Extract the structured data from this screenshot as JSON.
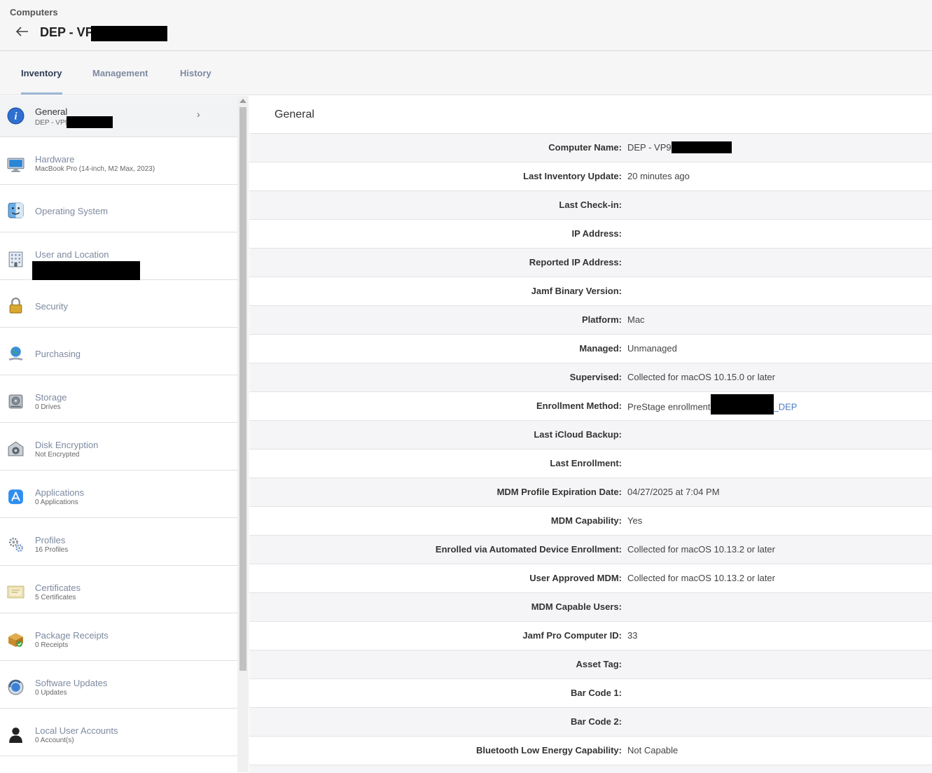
{
  "header": {
    "breadcrumb": "Computers",
    "title": "DEP - VP9"
  },
  "tabs": [
    "Inventory",
    "Management",
    "History"
  ],
  "sidebar": {
    "items": [
      {
        "label": "General",
        "sub": "DEP - VP9",
        "icon": "info-icon"
      },
      {
        "label": "Hardware",
        "sub": "MacBook Pro (14-inch, M2 Max, 2023)",
        "icon": "monitor-icon"
      },
      {
        "label": "Operating System",
        "sub": "",
        "icon": "finder-icon"
      },
      {
        "label": "User and Location",
        "sub": "",
        "icon": "building-icon"
      },
      {
        "label": "Security",
        "sub": "",
        "icon": "lock-icon"
      },
      {
        "label": "Purchasing",
        "sub": "",
        "icon": "globe-icon"
      },
      {
        "label": "Storage",
        "sub": "0 Drives",
        "icon": "drive-icon"
      },
      {
        "label": "Disk Encryption",
        "sub": "Not Encrypted",
        "icon": "vault-icon"
      },
      {
        "label": "Applications",
        "sub": "0 Applications",
        "icon": "app-store-icon"
      },
      {
        "label": "Profiles",
        "sub": "16 Profiles",
        "icon": "gears-icon"
      },
      {
        "label": "Certificates",
        "sub": "5 Certificates",
        "icon": "certificate-icon"
      },
      {
        "label": "Package Receipts",
        "sub": "0 Receipts",
        "icon": "package-icon"
      },
      {
        "label": "Software Updates",
        "sub": "0 Updates",
        "icon": "software-update-icon"
      },
      {
        "label": "Local User Accounts",
        "sub": "0 Account(s)",
        "icon": "user-icon"
      }
    ]
  },
  "main": {
    "section_title": "General",
    "rows": [
      {
        "label": "Computer Name:",
        "value": "DEP - VP9"
      },
      {
        "label": "Last Inventory Update:",
        "value": "20 minutes ago"
      },
      {
        "label": "Last Check-in:",
        "value": ""
      },
      {
        "label": "IP Address:",
        "value": ""
      },
      {
        "label": "Reported IP Address:",
        "value": ""
      },
      {
        "label": "Jamf Binary Version:",
        "value": ""
      },
      {
        "label": "Platform:",
        "value": "Mac"
      },
      {
        "label": "Managed:",
        "value": "Unmanaged"
      },
      {
        "label": "Supervised:",
        "value": "Collected for macOS 10.15.0 or later"
      },
      {
        "label": "Enrollment Method:",
        "value": "PreStage enrollment",
        "link_suffix": "_DEP"
      },
      {
        "label": "Last iCloud Backup:",
        "value": ""
      },
      {
        "label": "Last Enrollment:",
        "value": ""
      },
      {
        "label": "MDM Profile Expiration Date:",
        "value": "04/27/2025 at 7:04 PM"
      },
      {
        "label": "MDM Capability:",
        "value": "Yes"
      },
      {
        "label": "Enrolled via Automated Device Enrollment:",
        "value": "Collected for macOS 10.13.2 or later"
      },
      {
        "label": "User Approved MDM:",
        "value": "Collected for macOS 10.13.2 or later"
      },
      {
        "label": "MDM Capable Users:",
        "value": ""
      },
      {
        "label": "Jamf Pro Computer ID:",
        "value": "33"
      },
      {
        "label": "Asset Tag:",
        "value": ""
      },
      {
        "label": "Bar Code 1:",
        "value": ""
      },
      {
        "label": "Bar Code 2:",
        "value": ""
      },
      {
        "label": "Bluetooth Low Energy Capability:",
        "value": "Not Capable"
      }
    ]
  }
}
